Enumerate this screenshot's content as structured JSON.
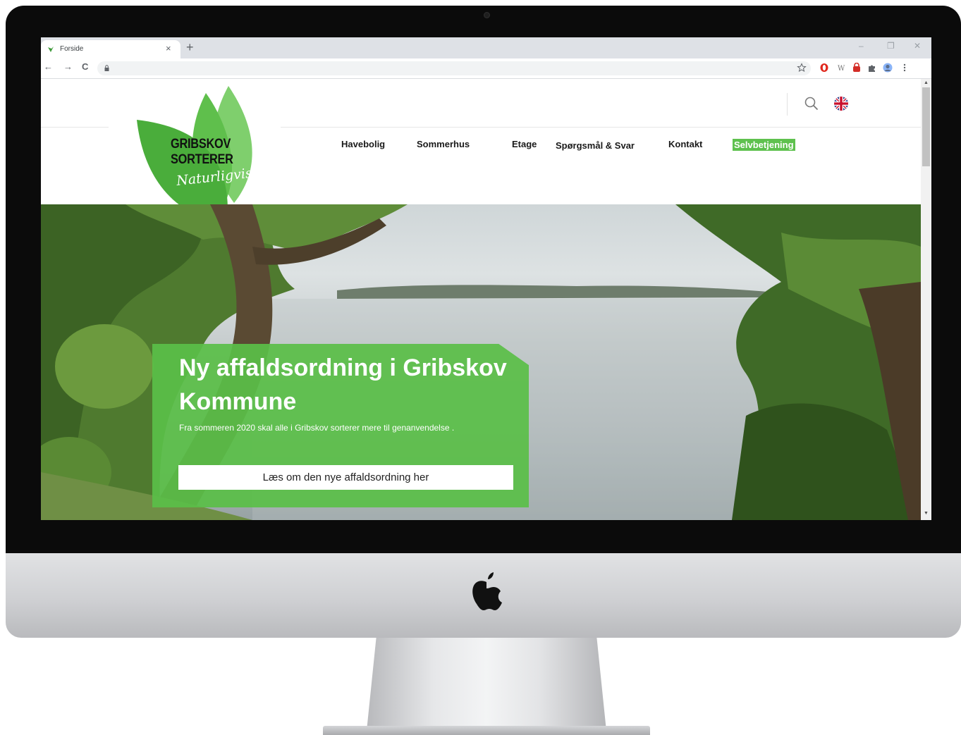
{
  "browser": {
    "tab_title": "Forside",
    "tab_close": "×",
    "new_tab": "+",
    "window_controls": {
      "minimize": "–",
      "restore": "❐",
      "close": "✕"
    },
    "nav": {
      "back": "←",
      "forward": "→",
      "reload": "C"
    },
    "extensions": [
      "star-icon",
      "opera-icon",
      "wikipedia-icon",
      "lastpass-icon",
      "puzzle-icon",
      "profile-avatar",
      "menu-icon"
    ]
  },
  "site": {
    "logo": {
      "line1": "GRIBSKOV",
      "line2": "SORTERER",
      "tagline": "Naturligvis!"
    },
    "nav_items": [
      "Havebolig",
      "Sommerhus",
      "Etage",
      "Spørgsmål & Svar",
      "Kontakt"
    ],
    "nav_highlight": "Selvbetjening",
    "header_icons": [
      "search-icon",
      "uk-flag-icon"
    ]
  },
  "hero": {
    "title": "Ny affaldsordning i Gribskov Kommune",
    "subtitle": "Fra sommeren 2020 skal alle i Gribskov sorterer mere til genanvendelse .",
    "button_label": "Læs om den nye affaldsordning her"
  },
  "colors": {
    "brand_green": "#5ec14e",
    "panel_green": "#5abe48",
    "bezel": "#0b0b0b"
  }
}
